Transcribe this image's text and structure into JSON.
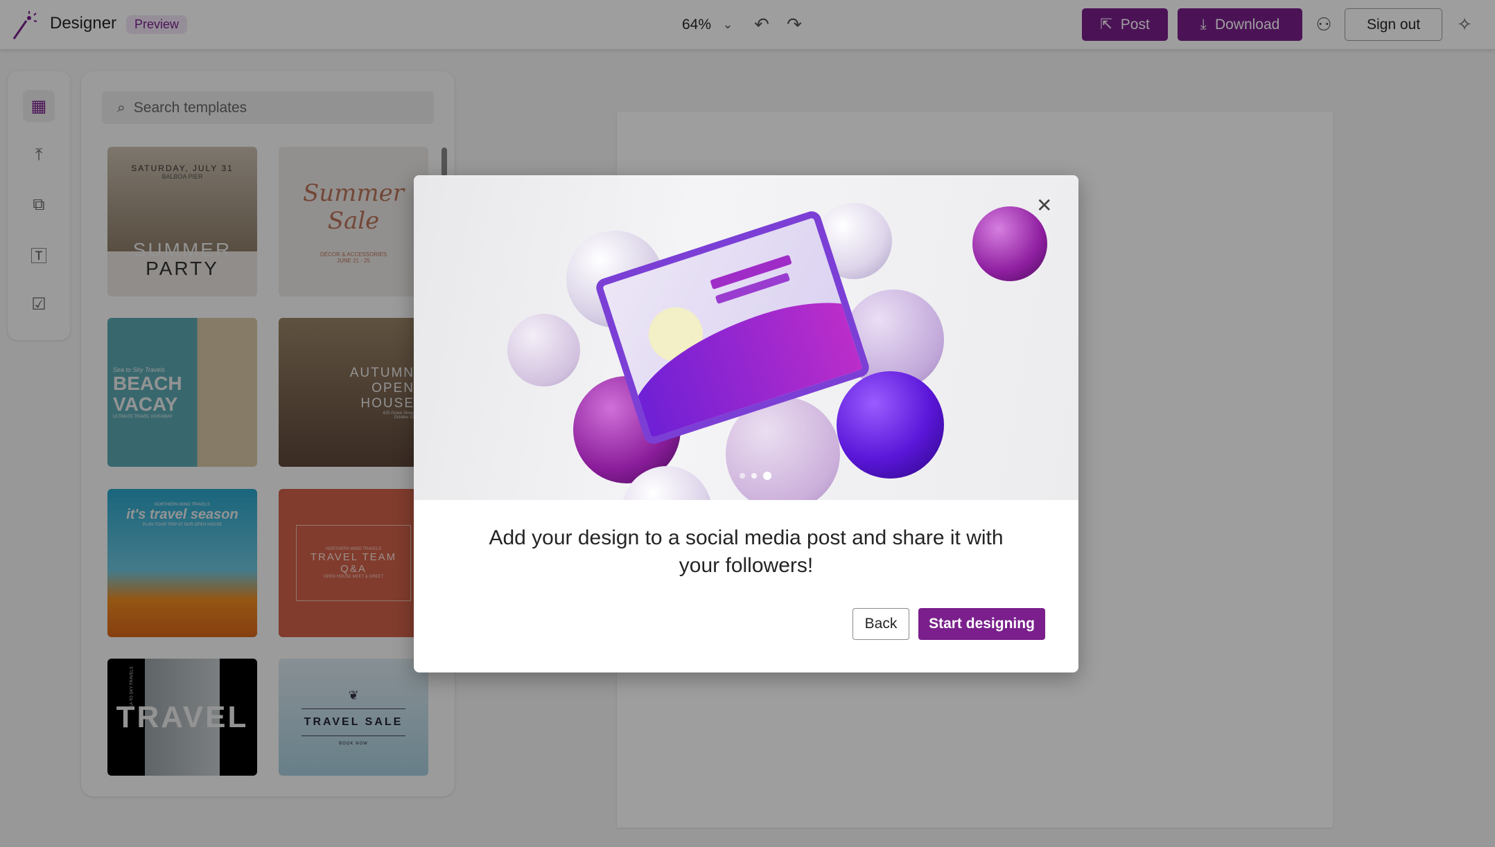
{
  "header": {
    "app_name": "Designer",
    "badge": "Preview",
    "zoom": "64%",
    "post_label": "Post",
    "download_label": "Download",
    "signout_label": "Sign out"
  },
  "rail": {
    "items": [
      "templates-icon",
      "upload-icon",
      "media-icon",
      "text-icon",
      "checklist-icon"
    ]
  },
  "panel": {
    "search_placeholder": "Search templates",
    "templates": [
      {
        "line1": "SATURDAY, JULY 31",
        "line2": "BALBOA PIER",
        "title": "SUMMER",
        "title2": "PARTY"
      },
      {
        "title": "Summer",
        "title2": "Sale",
        "line1": "DÉCOR & ACCESSORIES",
        "line2": "JUNE 21 - 25"
      },
      {
        "line1": "Sea to Sky Travels",
        "title": "BEACH",
        "title2": "VACAY",
        "line2": "ULTIMATE TRAVEL GIVEAWAY"
      },
      {
        "title": "AUTUMN",
        "title2": "OPEN",
        "title3": "HOUSE",
        "line1": "425 Grove Street",
        "line2": "October 23"
      },
      {
        "line1": "NORTHERN WIND TRAVELS",
        "title": "it's travel season",
        "line2": "PLAN YOUR TRIP AT OUR OPEN HOUSE"
      },
      {
        "line1": "NORTHERN WIND TRAVELS",
        "title": "TRAVEL TEAM",
        "title2": "Q&A",
        "line2": "OPEN HOUSE MEET & GREET"
      },
      {
        "title": "TRAVEL",
        "line1": "SEA TO SKY TRAVELS"
      },
      {
        "title": "TRAVEL SALE",
        "line1": "BOOK NOW"
      }
    ]
  },
  "modal": {
    "message": "Add your design to a social media post and share it with your followers!",
    "back_label": "Back",
    "start_label": "Start designing",
    "carousel": {
      "total": 3,
      "active": 3
    }
  },
  "colors": {
    "accent": "#7a1f8c"
  }
}
